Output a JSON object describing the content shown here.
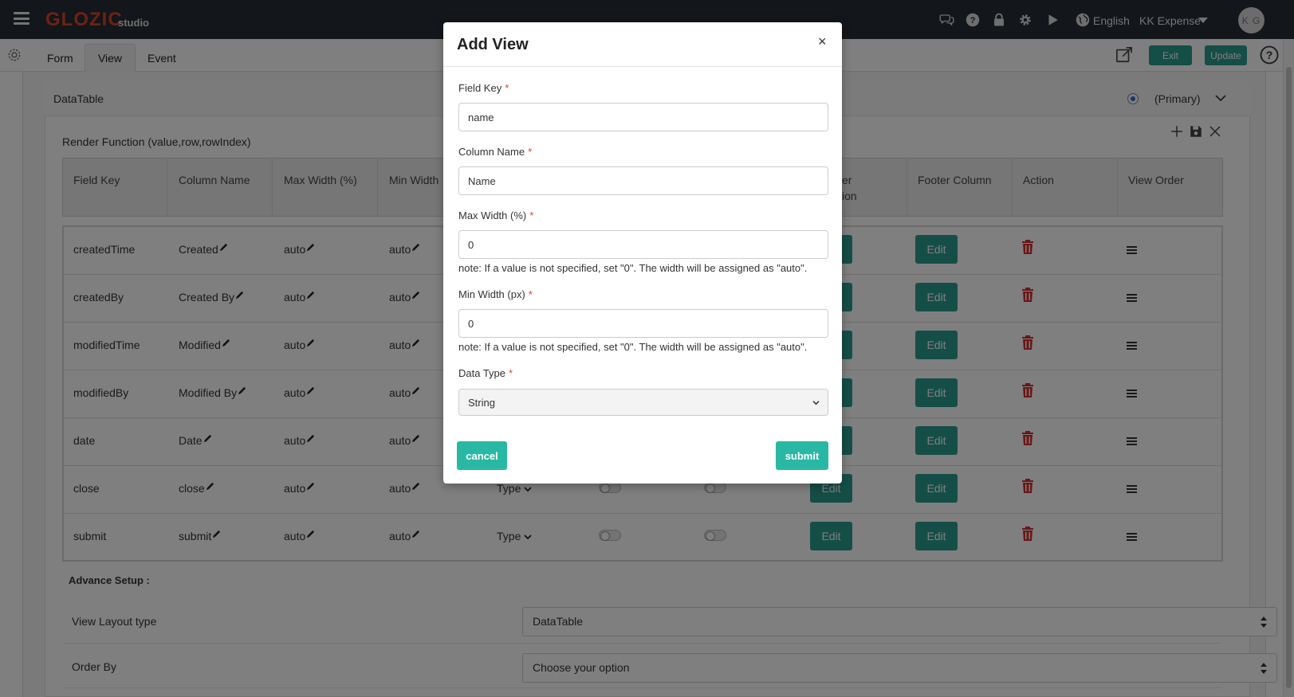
{
  "header": {
    "logo": "GLOZIC",
    "logo_sub": "studio",
    "language": "English",
    "company": "KK Expense",
    "avatar_initials": "K G",
    "icons": [
      "chat-icon",
      "question-icon",
      "lock-icon",
      "gear-icon",
      "play-icon",
      "globe-icon"
    ]
  },
  "tabs": {
    "form": "Form",
    "view": "View",
    "event": "Event",
    "active": "View"
  },
  "toolbar": {
    "exit_label": "Exit",
    "update_label": "Update"
  },
  "panel": {
    "title": "DataTable",
    "primary_label": "(Primary)",
    "render_function": "Render Function (value,row,rowIndex)"
  },
  "table": {
    "headers": {
      "field_key": "Field Key",
      "column_name": "Column Name",
      "max_width": "Max Width (%)",
      "min_width": "Min Width",
      "header_col_partial_1": "er",
      "header_col_partial_2": "ion",
      "footer_column": "Footer Column",
      "action": "Action",
      "view_order": "View Order"
    },
    "rows": [
      {
        "field_key": "createdTime",
        "column_name": "Created",
        "max_width": "auto",
        "min_width": "auto",
        "edit1": "Edit",
        "edit2": "Edit"
      },
      {
        "field_key": "createdBy",
        "column_name": "Created By",
        "max_width": "auto",
        "min_width": "auto",
        "edit1": "Edit",
        "edit2": "Edit"
      },
      {
        "field_key": "modifiedTime",
        "column_name": "Modified",
        "max_width": "auto",
        "min_width": "auto",
        "edit1": "Edit",
        "edit2": "Edit"
      },
      {
        "field_key": "modifiedBy",
        "column_name": "Modified By",
        "max_width": "auto",
        "min_width": "auto",
        "edit1": "Edit",
        "edit2": "Edit"
      },
      {
        "field_key": "date",
        "column_name": "Date",
        "max_width": "auto",
        "min_width": "auto",
        "edit1": "Edit",
        "edit2": "Edit"
      },
      {
        "field_key": "close",
        "column_name": "close",
        "max_width": "auto",
        "min_width": "auto",
        "type": "Type",
        "edit1": "Edit",
        "edit2": "Edit"
      },
      {
        "field_key": "submit",
        "column_name": "submit",
        "max_width": "auto",
        "min_width": "auto",
        "type": "Type",
        "edit1": "Edit",
        "edit2": "Edit"
      }
    ]
  },
  "advance": {
    "title": "Advance Setup :",
    "view_layout_label": "View Layout type",
    "view_layout_value": "DataTable",
    "order_by_label": "Order By",
    "order_by_value": "Choose your option"
  },
  "modal": {
    "title": "Add View",
    "close": "×",
    "field_key_label": "Field Key",
    "field_key_value": "name",
    "column_name_label": "Column Name",
    "column_name_value": "Name",
    "max_width_label": "Max Width (%)",
    "max_width_value": "0",
    "max_width_note": "note: If a value is not specified, set \"0\". The width will be assigned as \"auto\".",
    "min_width_label": "Min Width (px)",
    "min_width_value": "0",
    "min_width_note": "note: If a value is not specified, set \"0\". The width will be assigned as \"auto\".",
    "data_type_label": "Data Type",
    "data_type_value": "String",
    "required_mark": "*",
    "cancel_label": "cancel",
    "submit_label": "submit"
  },
  "colors": {
    "topbar": "#272c34",
    "brand": "#d8452a",
    "accent_green": "#2a9d8f",
    "modal_button": "#29b8a4",
    "required": "#e53935",
    "trash": "#d32f2f"
  }
}
